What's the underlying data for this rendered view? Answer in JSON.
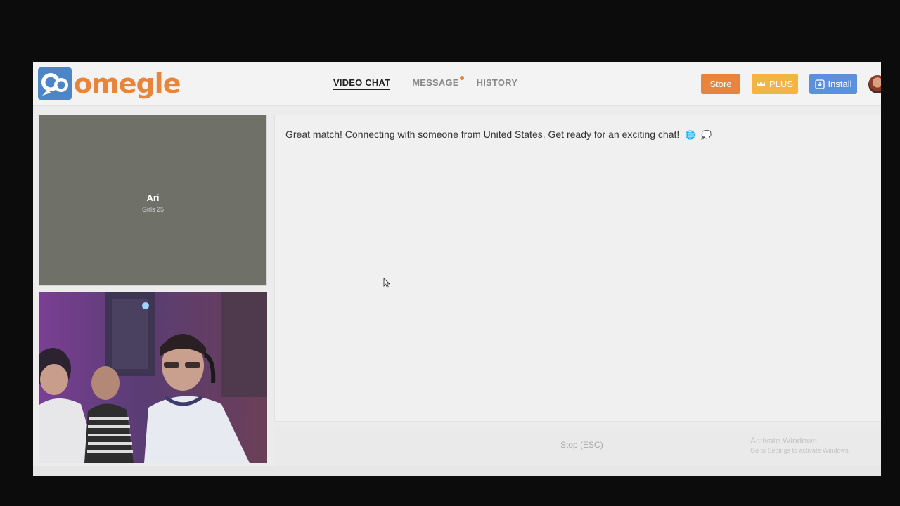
{
  "brand": {
    "logo_text": "omegle"
  },
  "nav": {
    "items": [
      {
        "label": "VIDEO CHAT",
        "active": true
      },
      {
        "label": "MESSAGE",
        "has_notification": true
      },
      {
        "label": "HISTORY"
      }
    ]
  },
  "header_buttons": {
    "store": "Store",
    "plus": "PLUS",
    "install": "Install"
  },
  "stranger": {
    "name": "Ari",
    "subtitle": "Girls 25"
  },
  "chat": {
    "message": "Great match! Connecting with someone from United States. Get ready for an exciting chat!"
  },
  "controls": {
    "stop_label": "Stop (ESC)"
  },
  "watermark": {
    "title": "Activate Windows",
    "subtitle": "Go to Settings to activate Windows."
  },
  "colors": {
    "brand_orange": "#e8853a",
    "store": "#e8843e",
    "plus": "#f2b544",
    "install": "#5b90de",
    "logo_blue": "#4a86c8"
  },
  "icons": [
    "omegle-logo-icon",
    "crown-icon",
    "download-icon",
    "globe-icon",
    "speech-bubble-icon",
    "mouse-cursor-icon"
  ]
}
